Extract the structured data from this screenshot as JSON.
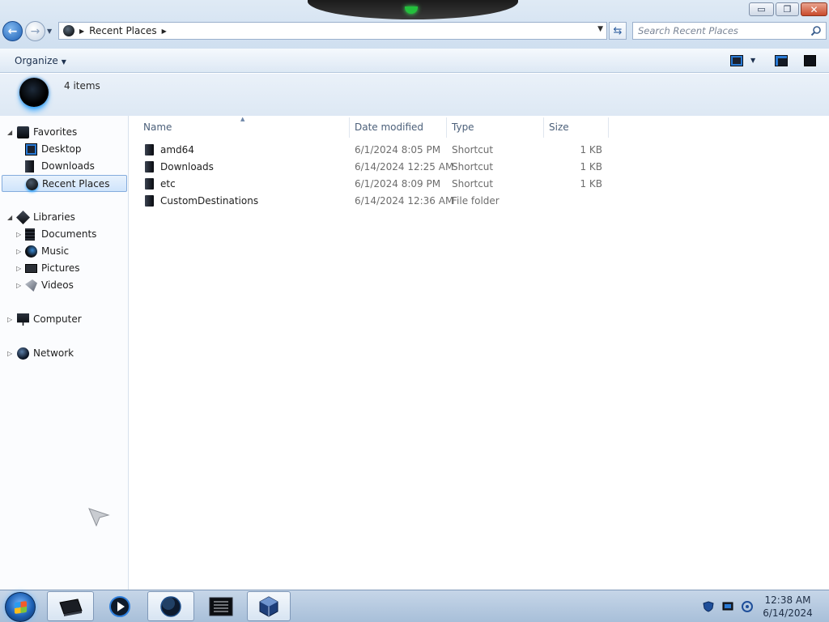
{
  "window": {
    "minimize_glyph": "▭",
    "maximize_glyph": "❐",
    "close_glyph": "✕"
  },
  "address": {
    "breadcrumb": "Recent Places"
  },
  "search": {
    "placeholder": "Search Recent Places"
  },
  "toolbar": {
    "organize_label": "Organize"
  },
  "infobar": {
    "item_count": "4 items"
  },
  "navigation": {
    "favorites_label": "Favorites",
    "favorites_items": [
      "Desktop",
      "Downloads",
      "Recent Places"
    ],
    "libraries_label": "Libraries",
    "libraries_items": [
      "Documents",
      "Music",
      "Pictures",
      "Videos"
    ],
    "computer_label": "Computer",
    "network_label": "Network",
    "selected": "Recent Places"
  },
  "columns": {
    "name": "Name",
    "date_modified": "Date modified",
    "type": "Type",
    "size": "Size"
  },
  "files": [
    {
      "name": "amd64",
      "date": "6/1/2024 8:05 PM",
      "type": "Shortcut",
      "size": "1 KB"
    },
    {
      "name": "Downloads",
      "date": "6/14/2024 12:25 AM",
      "type": "Shortcut",
      "size": "1 KB"
    },
    {
      "name": "etc",
      "date": "6/1/2024 8:09 PM",
      "type": "Shortcut",
      "size": "1 KB"
    },
    {
      "name": "CustomDestinations",
      "date": "6/14/2024 12:36 AM",
      "type": "File folder",
      "size": ""
    }
  ],
  "taskbar": {
    "time": "12:38 AM",
    "date": "6/14/2024",
    "pinned": [
      "explorer-icon",
      "media-player-icon",
      "browser-globe-icon",
      "terminal-icon",
      "virtualbox-icon"
    ]
  }
}
